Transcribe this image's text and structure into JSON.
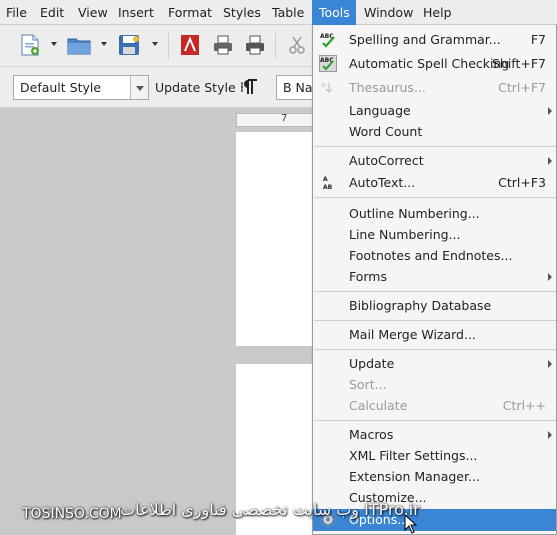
{
  "menubar": {
    "items": [
      {
        "label": "File"
      },
      {
        "label": "Edit"
      },
      {
        "label": "View"
      },
      {
        "label": "Insert"
      },
      {
        "label": "Format"
      },
      {
        "label": "Styles"
      },
      {
        "label": "Table"
      },
      {
        "label": "Tools"
      },
      {
        "label": "Window"
      },
      {
        "label": "Help"
      }
    ],
    "active": "Tools"
  },
  "toolbar": {
    "paragraph_style": "Default Style",
    "update_style_label": "Update Style",
    "font_name": "B Nazanin"
  },
  "ruler": {
    "mark": "7"
  },
  "tools_menu": {
    "items": [
      {
        "label": "Spelling and Grammar...",
        "shortcut": "F7",
        "icon": "spelling-icon"
      },
      {
        "label": "Automatic Spell Checking",
        "shortcut": "Shift+F7",
        "icon": "auto-spellcheck-icon"
      },
      {
        "label": "Thesaurus...",
        "shortcut": "Ctrl+F7",
        "disabled": true,
        "icon": "thesaurus-icon"
      },
      {
        "label": "Language",
        "submenu": true
      },
      {
        "label": "Word Count"
      },
      {
        "label": "AutoCorrect",
        "submenu": true
      },
      {
        "label": "AutoText...",
        "shortcut": "Ctrl+F3",
        "icon": "autotext-icon"
      },
      {
        "label": "Outline Numbering..."
      },
      {
        "label": "Line Numbering..."
      },
      {
        "label": "Footnotes and Endnotes..."
      },
      {
        "label": "Forms",
        "submenu": true
      },
      {
        "label": "Bibliography Database"
      },
      {
        "label": "Mail Merge Wizard..."
      },
      {
        "label": "Update",
        "submenu": true
      },
      {
        "label": "Sort...",
        "disabled": true
      },
      {
        "label": "Calculate",
        "shortcut": "Ctrl++",
        "disabled": true
      },
      {
        "label": "Macros",
        "submenu": true
      },
      {
        "label": "XML Filter Settings..."
      },
      {
        "label": "Extension Manager..."
      },
      {
        "label": "Customize..."
      },
      {
        "label": "Options...",
        "highlighted": true,
        "icon": "options-gear-icon"
      }
    ]
  },
  "watermark": {
    "left_text": "TOSINSO.COM",
    "right_text": "وب سایت تخصصی فناوری اطلاعات ITPro.ir"
  },
  "colors": {
    "menu_highlight": "#3a86d4",
    "menubar_bg": "#ededed",
    "menu_bg": "#f5f5f5",
    "doc_bg": "#c9c9c9"
  }
}
